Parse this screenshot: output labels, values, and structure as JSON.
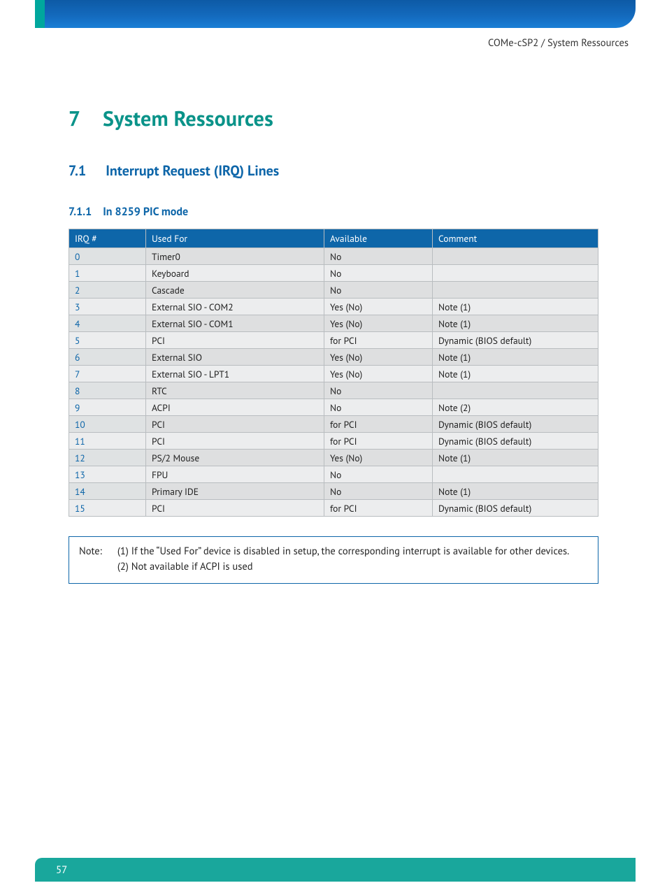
{
  "breadcrumb": "COMe-cSP2 / System Ressources",
  "chapter": {
    "num": "7",
    "title": "System Ressources"
  },
  "section": {
    "num": "7.1",
    "title": "Interrupt Request (IRQ) Lines"
  },
  "subsection": {
    "num": "7.1.1",
    "title": "In 8259 PIC mode"
  },
  "table": {
    "headers": {
      "irq": "IRQ #",
      "used": "Used For",
      "avail": "Available",
      "comment": "Comment"
    },
    "rows": [
      {
        "irq": "0",
        "used": "Timer0",
        "avail": "No",
        "comment": ""
      },
      {
        "irq": "1",
        "used": "Keyboard",
        "avail": "No",
        "comment": ""
      },
      {
        "irq": "2",
        "used": "Cascade",
        "avail": "No",
        "comment": ""
      },
      {
        "irq": "3",
        "used": "External SIO - COM2",
        "avail": "Yes (No)",
        "comment": "Note (1)"
      },
      {
        "irq": "4",
        "used": "External SIO - COM1",
        "avail": "Yes (No)",
        "comment": "Note (1)"
      },
      {
        "irq": "5",
        "used": "PCI",
        "avail": "for PCI",
        "comment": "Dynamic (BIOS default)"
      },
      {
        "irq": "6",
        "used": "External SIO",
        "avail": "Yes (No)",
        "comment": "Note (1)"
      },
      {
        "irq": "7",
        "used": "External SIO - LPT1",
        "avail": "Yes (No)",
        "comment": "Note (1)"
      },
      {
        "irq": "8",
        "used": "RTC",
        "avail": "No",
        "comment": ""
      },
      {
        "irq": "9",
        "used": "ACPI",
        "avail": "No",
        "comment": "Note (2)"
      },
      {
        "irq": "10",
        "used": "PCI",
        "avail": "for PCI",
        "comment": "Dynamic (BIOS default)"
      },
      {
        "irq": "11",
        "used": "PCI",
        "avail": "for PCI",
        "comment": "Dynamic (BIOS default)"
      },
      {
        "irq": "12",
        "used": "PS/2 Mouse",
        "avail": "Yes (No)",
        "comment": "Note (1)"
      },
      {
        "irq": "13",
        "used": "FPU",
        "avail": "No",
        "comment": ""
      },
      {
        "irq": "14",
        "used": "Primary IDE",
        "avail": "No",
        "comment": "Note (1)"
      },
      {
        "irq": "15",
        "used": "PCI",
        "avail": "for PCI",
        "comment": "Dynamic (BIOS default)"
      }
    ]
  },
  "note": {
    "label": "Note:",
    "line1": "(1) If the “Used For” device is disabled in setup, the corresponding interrupt is available for other devices.",
    "line2": "(2) Not available if ACPI is used"
  },
  "page_number": "57"
}
